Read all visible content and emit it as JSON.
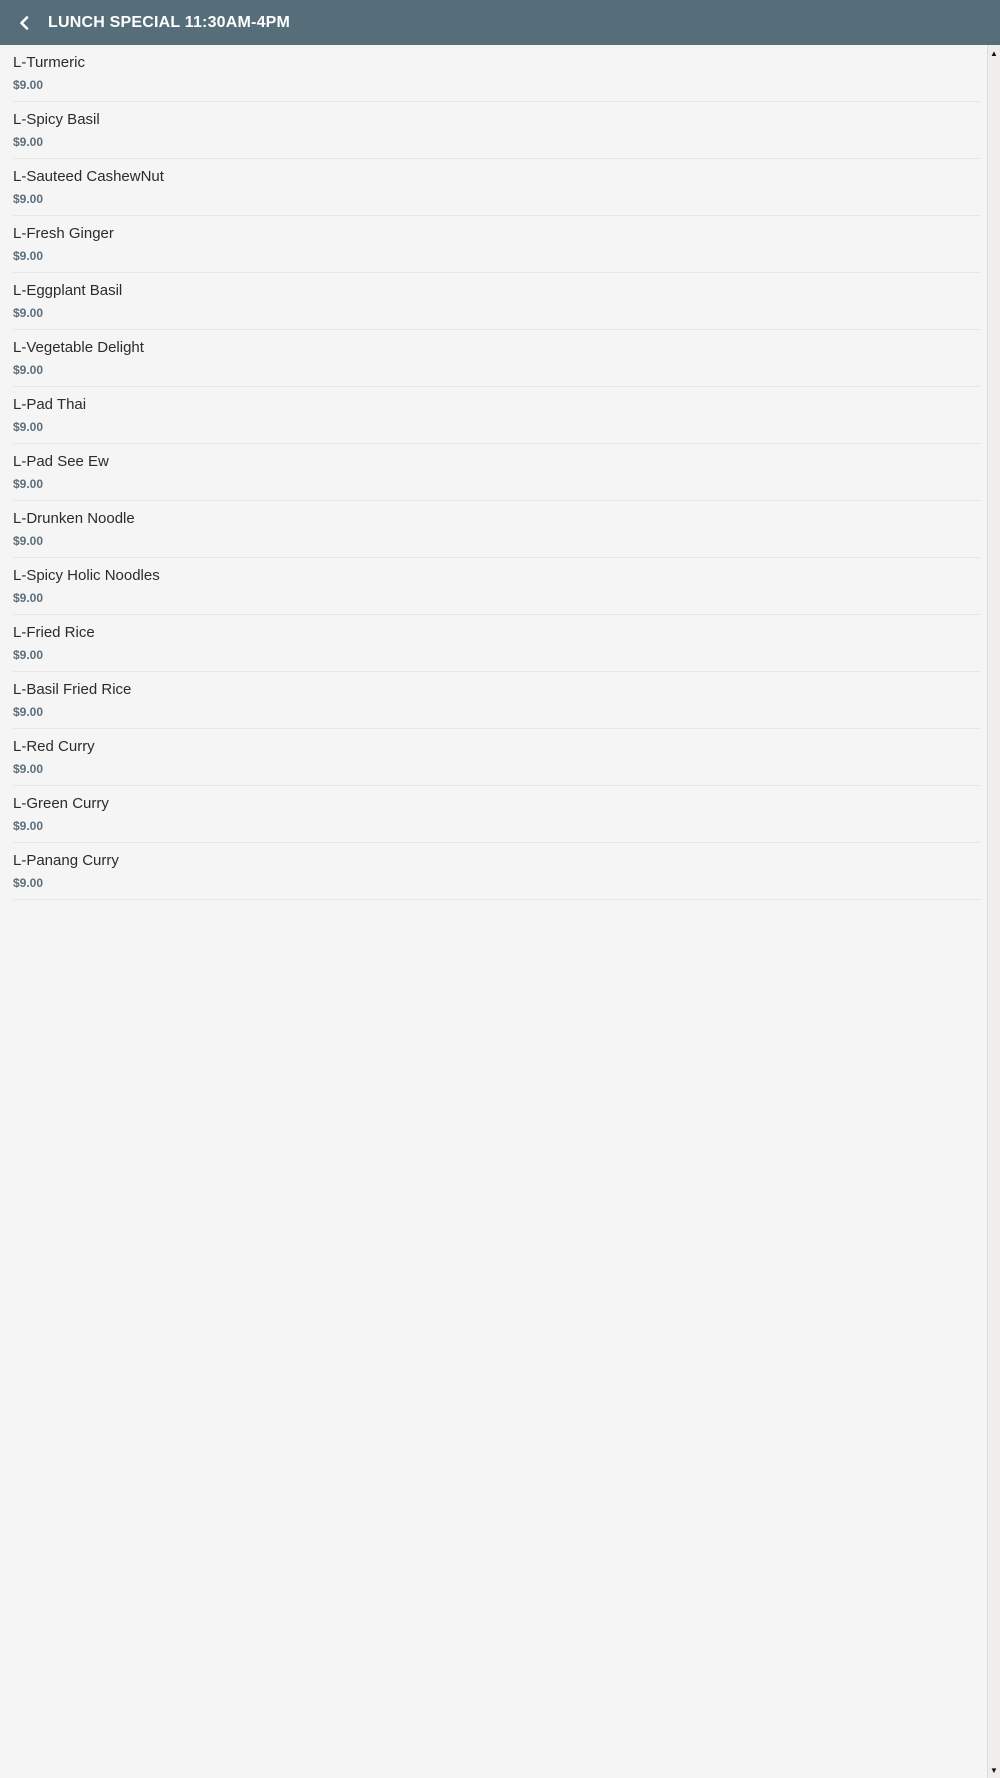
{
  "header": {
    "title": "LUNCH SPECIAL 11:30AM-4PM",
    "back_icon": "chevron-left-icon"
  },
  "colors": {
    "header_bg": "#566e7a",
    "page_bg": "#f5f5f5",
    "price": "#5a6f7b"
  },
  "items": [
    {
      "name": "L-Turmeric",
      "price": "$9.00"
    },
    {
      "name": "L-Spicy Basil",
      "price": "$9.00"
    },
    {
      "name": "L-Sauteed CashewNut",
      "price": "$9.00"
    },
    {
      "name": "L-Fresh Ginger",
      "price": "$9.00"
    },
    {
      "name": "L-Eggplant Basil",
      "price": "$9.00"
    },
    {
      "name": "L-Vegetable Delight",
      "price": "$9.00"
    },
    {
      "name": "L-Pad Thai",
      "price": "$9.00"
    },
    {
      "name": "L-Pad See Ew",
      "price": "$9.00"
    },
    {
      "name": "L-Drunken Noodle",
      "price": "$9.00"
    },
    {
      "name": "L-Spicy Holic Noodles",
      "price": "$9.00"
    },
    {
      "name": "L-Fried Rice",
      "price": "$9.00"
    },
    {
      "name": "L-Basil Fried Rice",
      "price": "$9.00"
    },
    {
      "name": "L-Red Curry",
      "price": "$9.00"
    },
    {
      "name": "L-Green Curry",
      "price": "$9.00"
    },
    {
      "name": "L-Panang Curry",
      "price": "$9.00"
    }
  ]
}
